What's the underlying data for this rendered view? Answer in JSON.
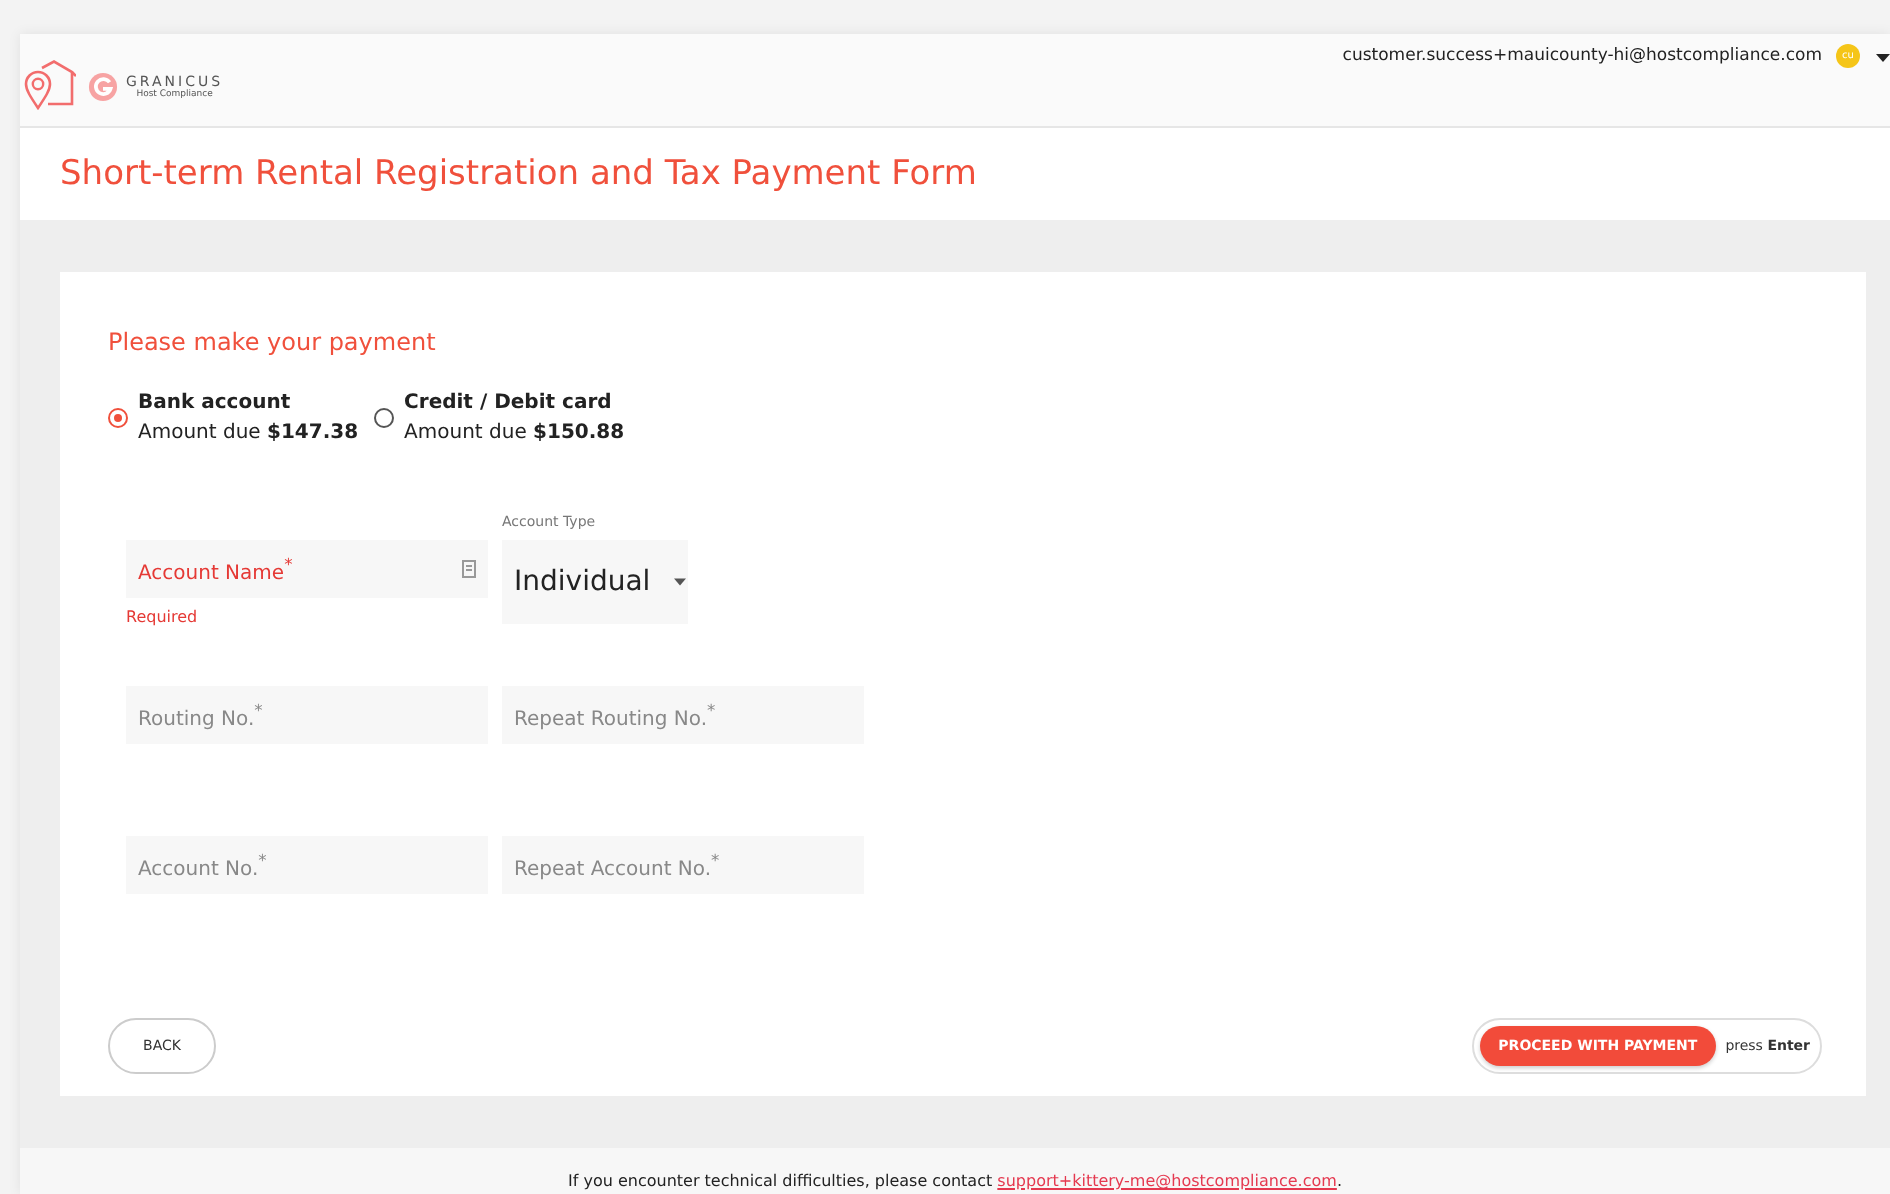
{
  "header": {
    "logo": {
      "wordmark": "GRANICUS",
      "tagline": "Host Compliance"
    },
    "user": {
      "email": "customer.success+mauicounty-hi@hostcompliance.com",
      "initials": "cu"
    }
  },
  "page_title": "Short-term Rental Registration and Tax Payment Form",
  "form": {
    "heading": "Please make your payment",
    "methods": [
      {
        "label": "Bank account",
        "amount": "Amount due **$147.38**",
        "selected": true
      },
      {
        "label": "Credit / Debit card",
        "amount": "Amount due **$150.88**",
        "selected": false
      }
    ],
    "account_name": {
      "label": "Account Name$^{*}$",
      "error": true,
      "error_text": "Required"
    },
    "account_type": {
      "label": "Account Type",
      "value": "Individual"
    },
    "field_rows": [
      [
        {
          "label": "Routing No.$^{*}$"
        },
        {
          "label": "Repeat Routing No.$^{*}$"
        }
      ],
      [
        {
          "label": "Account No.$^{*}$"
        },
        {
          "label": "Repeat Account No.$^{*}$"
        }
      ]
    ],
    "back_button": "BACK",
    "proceed_button": "PROCEED WITH PAYMENT",
    "hint": "press **Enter**"
  },
  "footer": {
    "text": "If you encounter technical difficulties, please contact ",
    "link": "support+kittery-me@hostcompliance.com",
    "end": "."
  }
}
